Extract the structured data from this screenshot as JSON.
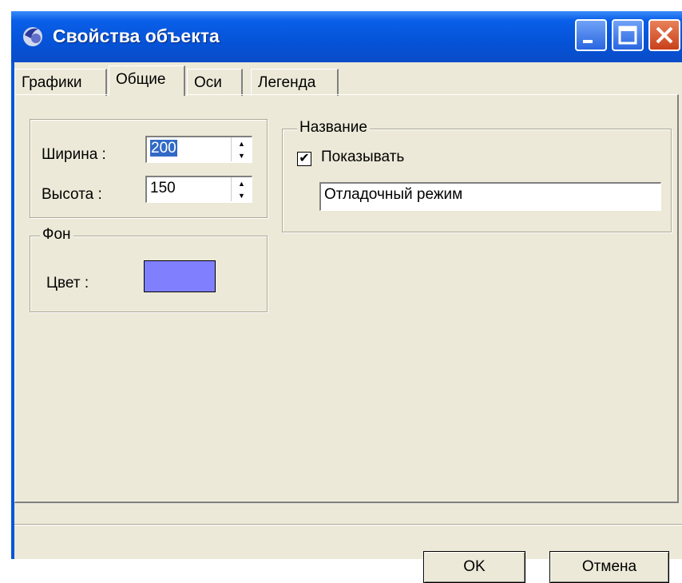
{
  "window": {
    "title": "Свойства объекта"
  },
  "tabs": [
    {
      "label": "Графики"
    },
    {
      "label": "Общие"
    },
    {
      "label": "Оси"
    },
    {
      "label": "Легенда"
    }
  ],
  "size": {
    "width_label": "Ширина :",
    "width_value": "200",
    "height_label": "Высота :",
    "height_value": "150"
  },
  "background": {
    "group_label": "Фон",
    "color_label": "Цвет :",
    "color": "#8080ff"
  },
  "title_group": {
    "group_label": "Название",
    "show_label": "Показывать",
    "show_checked": "✔",
    "text_value": "Отладочный режим"
  },
  "buttons": {
    "ok": "OK",
    "cancel": "Отмена"
  },
  "colors": {
    "titlebar": "#0553d8",
    "face": "#ece9d8",
    "swatch": "#8080ff"
  }
}
